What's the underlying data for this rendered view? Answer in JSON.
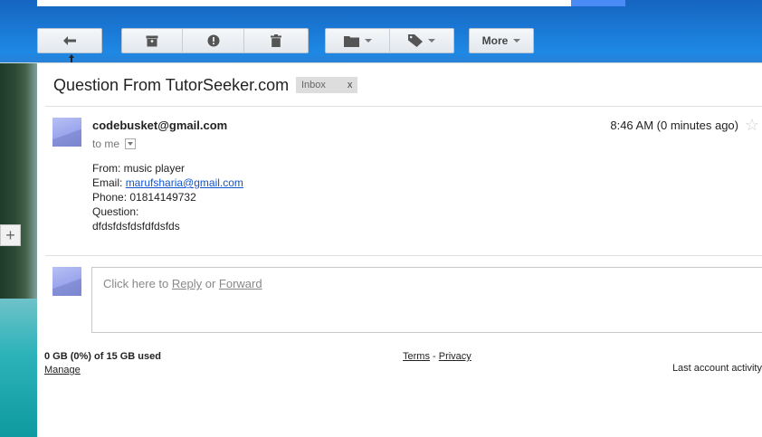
{
  "toolbar": {
    "more_label": "More",
    "icons": {
      "back": "back-arrow-icon",
      "archive": "archive-icon",
      "spam": "report-spam-icon",
      "delete": "trash-icon",
      "move": "folder-icon",
      "labels": "label-tag-icon"
    }
  },
  "email": {
    "subject": "Question From TutorSeeker.com",
    "label": "Inbox",
    "label_remove": "x",
    "sender": "codebusket@gmail.com",
    "recipient": "to me",
    "time": "8:46 AM (0 minutes ago)",
    "star": "☆",
    "body": {
      "from_line": "From: music player",
      "email_prefix": "Email: ",
      "email_link": "marufsharia@gmail.com",
      "phone_line": "Phone: 01814149732",
      "question_label": "Question:",
      "question_text": "dfdsfdsfdsfdfdsfds"
    }
  },
  "reply": {
    "prefix": "Click here to ",
    "reply_link": "Reply",
    "middle": " or ",
    "forward_link": "Forward"
  },
  "footer": {
    "storage": "0 GB (0%) of 15 GB used",
    "manage": "Manage",
    "terms": "Terms",
    "separator": " - ",
    "privacy": "Privacy",
    "last_activity": "Last account activity"
  },
  "side": {
    "plus": "+"
  },
  "colors": {
    "link": "#1155cc",
    "label_bg": "#dddddd",
    "search_button": "#4a8af4"
  }
}
